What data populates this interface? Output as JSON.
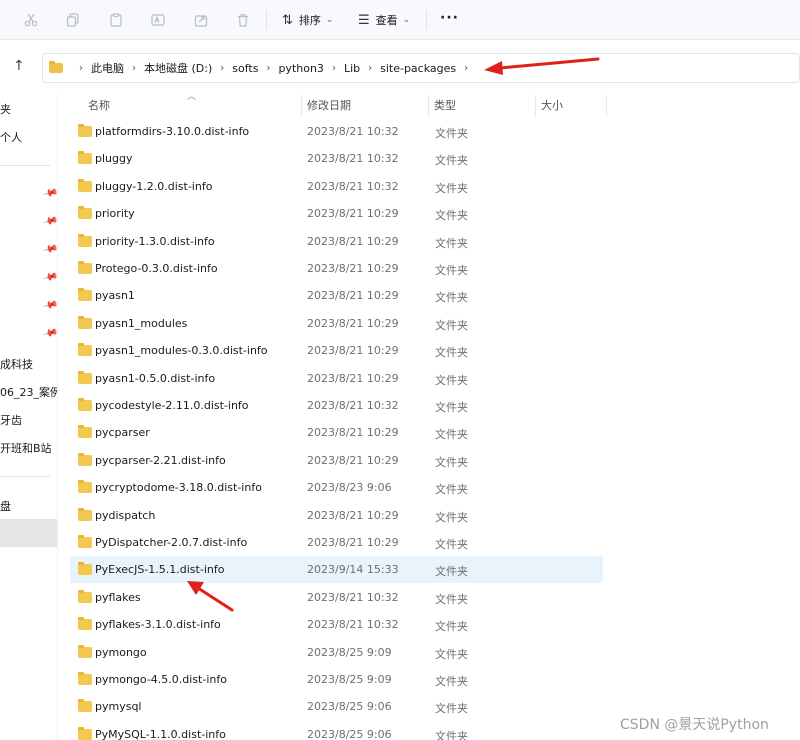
{
  "toolbar": {
    "icons": [
      "cut-icon",
      "copy-icon",
      "paste-icon",
      "rename-icon",
      "share-icon",
      "delete-icon"
    ],
    "sort_label": "排序",
    "view_label": "查看",
    "more_label": "···"
  },
  "address": {
    "crumbs": [
      "此电脑",
      "本地磁盘 (D:)",
      "softs",
      "python3",
      "Lib",
      "site-packages"
    ]
  },
  "sidebar": {
    "items": [
      "夹",
      "个人",
      "成科技",
      "06_23_案例",
      "牙齿",
      "开班和B站",
      "盘"
    ]
  },
  "columns": {
    "name": "名称",
    "date": "修改日期",
    "type": "类型",
    "size": "大小"
  },
  "files": [
    {
      "name": "platformdirs-3.10.0.dist-info",
      "date": "2023/8/21 10:32",
      "type": "文件夹"
    },
    {
      "name": "pluggy",
      "date": "2023/8/21 10:32",
      "type": "文件夹"
    },
    {
      "name": "pluggy-1.2.0.dist-info",
      "date": "2023/8/21 10:32",
      "type": "文件夹"
    },
    {
      "name": "priority",
      "date": "2023/8/21 10:29",
      "type": "文件夹"
    },
    {
      "name": "priority-1.3.0.dist-info",
      "date": "2023/8/21 10:29",
      "type": "文件夹"
    },
    {
      "name": "Protego-0.3.0.dist-info",
      "date": "2023/8/21 10:29",
      "type": "文件夹"
    },
    {
      "name": "pyasn1",
      "date": "2023/8/21 10:29",
      "type": "文件夹"
    },
    {
      "name": "pyasn1_modules",
      "date": "2023/8/21 10:29",
      "type": "文件夹"
    },
    {
      "name": "pyasn1_modules-0.3.0.dist-info",
      "date": "2023/8/21 10:29",
      "type": "文件夹"
    },
    {
      "name": "pyasn1-0.5.0.dist-info",
      "date": "2023/8/21 10:29",
      "type": "文件夹"
    },
    {
      "name": "pycodestyle-2.11.0.dist-info",
      "date": "2023/8/21 10:32",
      "type": "文件夹"
    },
    {
      "name": "pycparser",
      "date": "2023/8/21 10:29",
      "type": "文件夹"
    },
    {
      "name": "pycparser-2.21.dist-info",
      "date": "2023/8/21 10:29",
      "type": "文件夹"
    },
    {
      "name": "pycryptodome-3.18.0.dist-info",
      "date": "2023/8/23 9:06",
      "type": "文件夹"
    },
    {
      "name": "pydispatch",
      "date": "2023/8/21 10:29",
      "type": "文件夹"
    },
    {
      "name": "PyDispatcher-2.0.7.dist-info",
      "date": "2023/8/21 10:29",
      "type": "文件夹"
    },
    {
      "name": "PyExecJS-1.5.1.dist-info",
      "date": "2023/9/14 15:33",
      "type": "文件夹",
      "selected": true
    },
    {
      "name": "pyflakes",
      "date": "2023/8/21 10:32",
      "type": "文件夹"
    },
    {
      "name": "pyflakes-3.1.0.dist-info",
      "date": "2023/8/21 10:32",
      "type": "文件夹"
    },
    {
      "name": "pymongo",
      "date": "2023/8/25 9:09",
      "type": "文件夹"
    },
    {
      "name": "pymongo-4.5.0.dist-info",
      "date": "2023/8/25 9:09",
      "type": "文件夹"
    },
    {
      "name": "pymysql",
      "date": "2023/8/25 9:06",
      "type": "文件夹"
    },
    {
      "name": "PyMySQL-1.1.0.dist-info",
      "date": "2023/8/25 9:06",
      "type": "文件夹"
    }
  ],
  "watermark": "CSDN @景天说Python",
  "colors": {
    "accent_arrow": "#e0201b",
    "folder": "#f3c84f",
    "selected_row": "#e9f3fc"
  }
}
